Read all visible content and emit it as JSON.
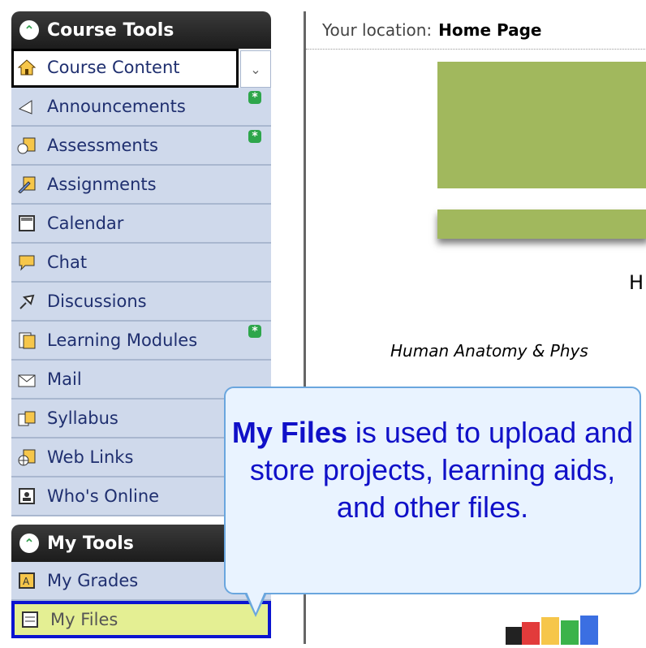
{
  "course_tools": {
    "title": "Course Tools",
    "items": [
      {
        "label": "Course Content",
        "icon": "home-icon",
        "active": true
      },
      {
        "label": "Announcements",
        "icon": "megaphone-icon",
        "new": true
      },
      {
        "label": "Assessments",
        "icon": "stopwatch-icon",
        "new": true
      },
      {
        "label": "Assignments",
        "icon": "pencil-icon"
      },
      {
        "label": "Calendar",
        "icon": "calendar-icon"
      },
      {
        "label": "Chat",
        "icon": "chat-bubble-icon"
      },
      {
        "label": "Discussions",
        "icon": "pushpin-icon"
      },
      {
        "label": "Learning Modules",
        "icon": "document-icon",
        "new": true
      },
      {
        "label": "Mail",
        "icon": "envelope-icon"
      },
      {
        "label": "Syllabus",
        "icon": "book-icon"
      },
      {
        "label": "Web Links",
        "icon": "globe-icon"
      },
      {
        "label": "Who's Online",
        "icon": "person-icon"
      }
    ]
  },
  "my_tools": {
    "title": "My Tools",
    "items": [
      {
        "label": "My Grades",
        "icon": "grades-icon"
      },
      {
        "label": "My Files",
        "icon": "files-icon",
        "selected": true
      }
    ]
  },
  "location": {
    "prefix": "Your location:",
    "value": "Home Page"
  },
  "page": {
    "heading_partial": "H",
    "subtitle_partial": "Human Anatomy & Phys"
  },
  "callout": {
    "bold": "My Files",
    "rest": " is used to upload and store projects, learning aids, and other files."
  },
  "colors": {
    "accent_green": "#2ea64b",
    "nav_bg": "#cfd9eb",
    "callout_text": "#1010c8",
    "banner": "#a1b85d"
  }
}
